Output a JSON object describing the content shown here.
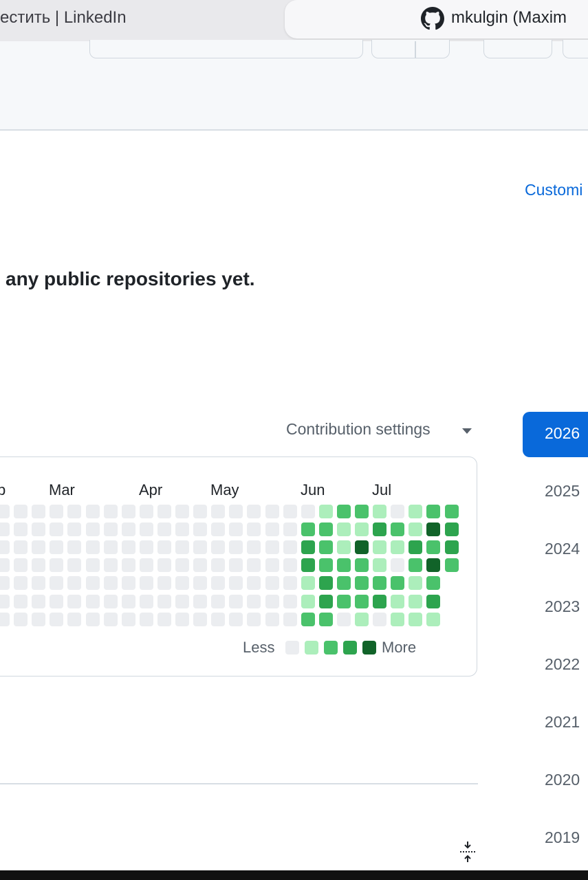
{
  "browser": {
    "inactive_tab_title": "естить | LinkedIn",
    "active_tab_title": "mkulgin (Maxim",
    "active_tab_icon": "github-octocat-icon"
  },
  "profile": {
    "customize_link": "Customi",
    "no_repos_message": "any public repositories yet."
  },
  "contributions": {
    "settings_label": "Contribution settings",
    "months": [
      "b",
      "Mar",
      "Apr",
      "May",
      "Jun",
      "Jul"
    ],
    "legend": {
      "less": "Less",
      "more": "More"
    },
    "level_colors": [
      "#ebedf0",
      "#aceebb",
      "#4ac26b",
      "#2da44e",
      "#116329"
    ],
    "grid_levels": [
      [
        0,
        0,
        0,
        0,
        0,
        0,
        0,
        0,
        0,
        0,
        0,
        0,
        0,
        0,
        0,
        0,
        0,
        0,
        1,
        2,
        2,
        1,
        0,
        1,
        2,
        2
      ],
      [
        0,
        0,
        0,
        0,
        0,
        0,
        0,
        0,
        0,
        0,
        0,
        0,
        0,
        0,
        0,
        0,
        0,
        2,
        2,
        1,
        1,
        3,
        2,
        1,
        4,
        3
      ],
      [
        0,
        0,
        0,
        0,
        0,
        0,
        0,
        0,
        0,
        0,
        0,
        0,
        0,
        0,
        0,
        0,
        0,
        3,
        2,
        1,
        4,
        1,
        1,
        3,
        2,
        3
      ],
      [
        0,
        0,
        0,
        0,
        0,
        0,
        0,
        0,
        0,
        0,
        0,
        0,
        0,
        0,
        0,
        0,
        0,
        3,
        2,
        2,
        2,
        1,
        0,
        2,
        4,
        2
      ],
      [
        0,
        0,
        0,
        0,
        0,
        0,
        0,
        0,
        0,
        0,
        0,
        0,
        0,
        0,
        0,
        0,
        0,
        1,
        3,
        2,
        2,
        2,
        2,
        1,
        2,
        -1
      ],
      [
        0,
        0,
        0,
        0,
        0,
        0,
        0,
        0,
        0,
        0,
        0,
        0,
        0,
        0,
        0,
        0,
        0,
        1,
        3,
        2,
        2,
        3,
        1,
        1,
        3,
        -1
      ],
      [
        0,
        0,
        0,
        0,
        0,
        0,
        0,
        0,
        0,
        0,
        0,
        0,
        0,
        0,
        0,
        0,
        0,
        2,
        2,
        0,
        1,
        0,
        1,
        1,
        1,
        -1
      ]
    ]
  },
  "years": {
    "items": [
      "2026",
      "2025",
      "2024",
      "2023",
      "2022",
      "2021",
      "2020",
      "2019"
    ],
    "selected": "2026"
  }
}
